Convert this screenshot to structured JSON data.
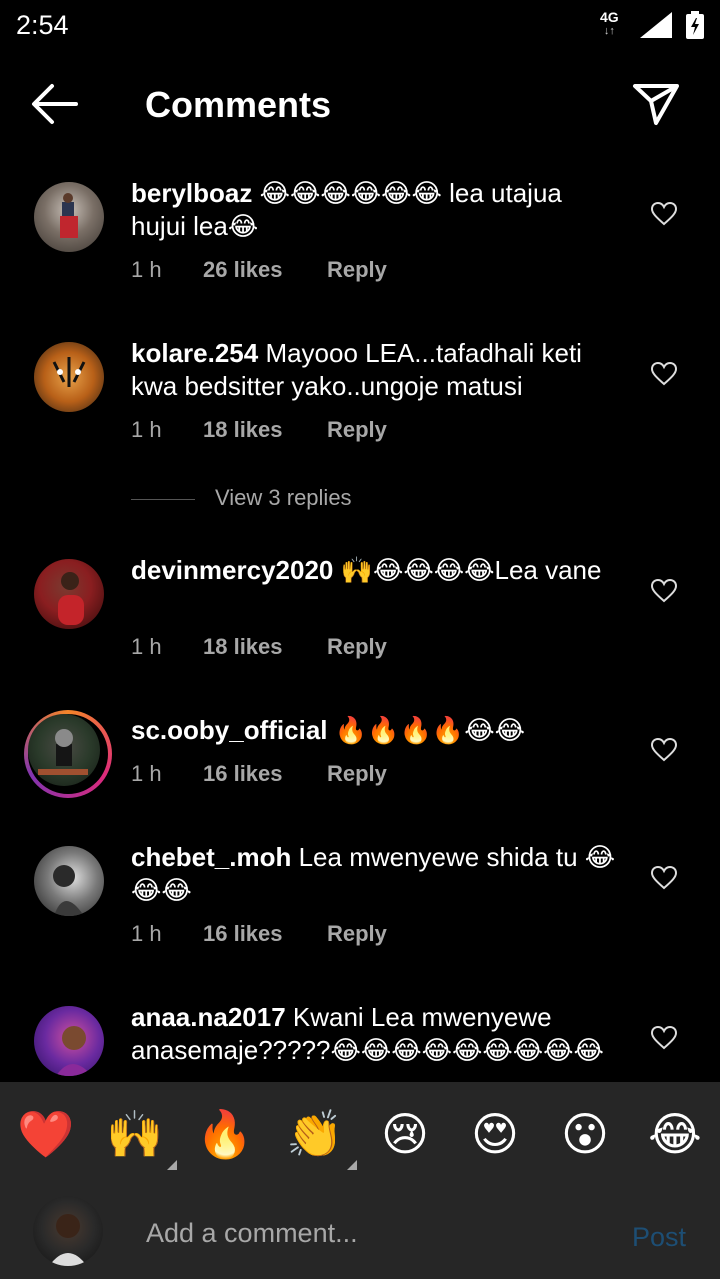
{
  "status": {
    "time": "2:54",
    "network": "4G"
  },
  "header": {
    "title": "Comments",
    "back_icon": "arrow-left-icon",
    "send_icon": "paper-plane-icon"
  },
  "comments": [
    {
      "user": "berylboaz",
      "text": " 😂😂😂😂😂😂 lea utajua hujui lea😂",
      "time": "1 h",
      "likes": "26 likes",
      "reply": "Reply"
    },
    {
      "user": "kolare.254",
      "text": " Mayooo LEA...tafadhali keti kwa bedsitter yako..ungoje matusi",
      "time": "1 h",
      "likes": "18 likes",
      "reply": "Reply"
    },
    {
      "user": "devinmercy2020",
      "text": " 🙌😂😂😂😂Lea vane",
      "time": "1 h",
      "likes": "18 likes",
      "reply": "Reply"
    },
    {
      "user": "sc.ooby_official",
      "text": " 🔥🔥🔥🔥😂😂",
      "time": "1 h",
      "likes": "16 likes",
      "reply": "Reply"
    },
    {
      "user": "chebet_.moh",
      "text": " Lea mwenyewe shida tu 😂😂😂",
      "time": "1 h",
      "likes": "16 likes",
      "reply": "Reply"
    },
    {
      "user": "anaa.na2017",
      "text": " Kwani Lea mwenyewe anasemaje?????😂😂😂😂😂😂😂😂😂",
      "time": "",
      "likes": "",
      "reply": ""
    }
  ],
  "view_replies": "View 3 replies",
  "emoji_bar": [
    "❤️",
    "🙌",
    "🔥",
    "👏",
    "😢",
    "😍",
    "😮",
    "😂"
  ],
  "composer": {
    "placeholder": "Add a comment...",
    "post_label": "Post"
  },
  "colors": {
    "background": "#000000",
    "bar": "#262626",
    "meta": "#a8a8a8",
    "post": "#1d4e74"
  }
}
